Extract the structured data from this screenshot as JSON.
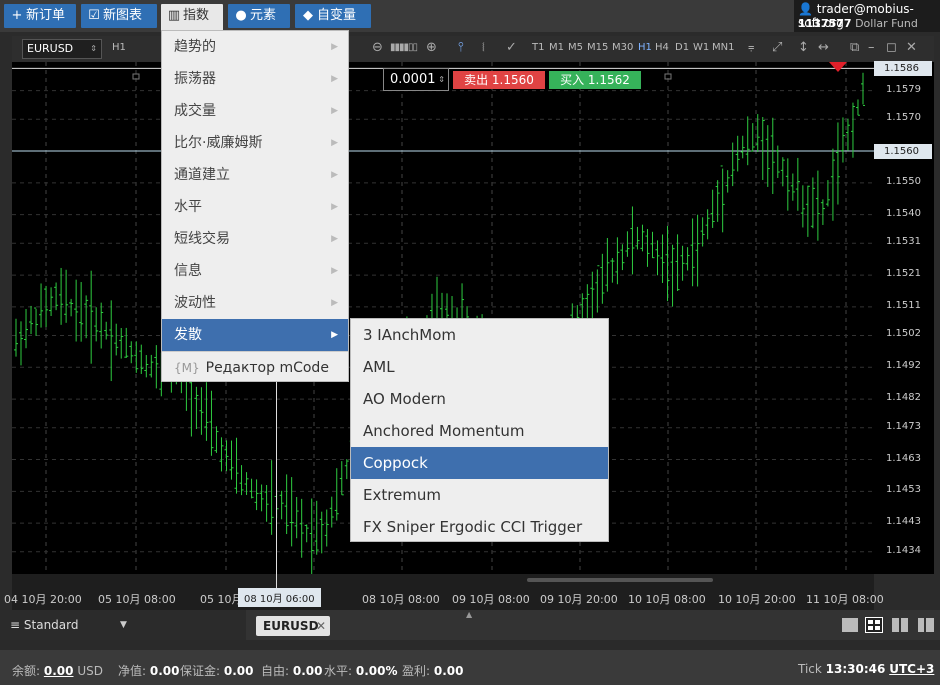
{
  "toolbar": {
    "new_order": "新订单",
    "new_chart": "新图表",
    "indicators": "指数",
    "objects": "元素",
    "variables": "自变量"
  },
  "account": {
    "user": "trader@mobius-soft.org",
    "number": "1137577",
    "name": "Dollar Fund"
  },
  "chart": {
    "symbol": "EURUSD",
    "timeframe": "H1",
    "timeframes": [
      "T1",
      "M1",
      "M5",
      "M15",
      "M30",
      "H1",
      "H4",
      "D1",
      "W1",
      "MN1"
    ],
    "active_timeframe": "H1",
    "lot": "0.0001",
    "sell_label": "卖出 1.1560",
    "buy_label": "买入 1.1562",
    "price_ticks": [
      "1.1579",
      "1.1570",
      "1.1550",
      "1.1540",
      "1.1531",
      "1.1521",
      "1.1511",
      "1.1502",
      "1.1492",
      "1.1482",
      "1.1473",
      "1.1463",
      "1.1453",
      "1.1443",
      "1.1434"
    ],
    "ask_box": "1.1586",
    "bid_box": "1.1560",
    "date_ticks": [
      "04 10月 20:00",
      "05 10月 08:00",
      "05 10月",
      "08 10月 08:00",
      "09 10月 08:00",
      "09 10月 20:00",
      "10 10月 08:00",
      "10 10月 20:00",
      "11 10月 08:00"
    ],
    "cursor_date": "08 10月 06:00"
  },
  "chart_data": {
    "type": "candlestick",
    "symbol": "EURUSD",
    "timeframe": "H1",
    "y_ticks": [
      1.1579,
      1.157,
      1.155,
      1.154,
      1.1531,
      1.1521,
      1.1511,
      1.1502,
      1.1492,
      1.1482,
      1.1473,
      1.1463,
      1.1453,
      1.1443,
      1.1434
    ],
    "ylim": [
      1.1427,
      1.1588
    ],
    "x_ticks": [
      "04 10月 20:00",
      "05 10月 08:00",
      "05 10月",
      "08 10月 08:00",
      "09 10月 08:00",
      "09 10月 20:00",
      "10 10月 08:00",
      "10 10月 20:00",
      "11 10月 08:00"
    ],
    "ask": 1.1586,
    "bid": 1.156,
    "approx_close_path": [
      1.15,
      1.1508,
      1.1514,
      1.151,
      1.1506,
      1.15,
      1.1495,
      1.149,
      1.1492,
      1.1478,
      1.1465,
      1.1456,
      1.145,
      1.1448,
      1.144,
      1.1442,
      1.146,
      1.1475,
      1.149,
      1.15,
      1.1506,
      1.1508,
      1.1505,
      1.15,
      1.149,
      1.1488,
      1.1495,
      1.1505,
      1.1515,
      1.1525,
      1.1533,
      1.1528,
      1.1522,
      1.153,
      1.1545,
      1.156,
      1.1565,
      1.1555,
      1.1545,
      1.154,
      1.156,
      1.1578
    ]
  },
  "indicator_menu": {
    "items": [
      "趋势的",
      "振荡器",
      "成交量",
      "比尔·威廉姆斯",
      "通道建立",
      "水平",
      "短线交易",
      "信息",
      "波动性",
      "发散"
    ],
    "selected": "发散",
    "mcode": "Редактор mCode"
  },
  "divergence_submenu": {
    "items": [
      "3 IAnchMom",
      "AML",
      "AO Modern",
      "Anchored Momentum",
      "Coppock",
      "Extremum",
      "FX Sniper Ergodic CCI Trigger"
    ],
    "selected": "Coppock"
  },
  "tabs": {
    "profile": "Standard",
    "symbol_tab": "EURUSD"
  },
  "status": {
    "balance_label": "余额:",
    "balance": "0.00",
    "currency": "USD",
    "equity_label": "净值:",
    "equity": "0.00",
    "margin_label": "保证金:",
    "margin": "0.00",
    "free_label": "自由:",
    "free": "0.00",
    "level_label": "水平:",
    "level": "0.00%",
    "profit_label": "盈利:",
    "profit": "0.00",
    "tick_label": "Tick",
    "time": "13:30:46",
    "tz": "UTC+3"
  },
  "colors": {
    "accent": "#2f6fb4",
    "menu_selected": "#3e6fae",
    "sell": "#e04343",
    "buy": "#36b25a",
    "candle": "#2ecc40"
  }
}
